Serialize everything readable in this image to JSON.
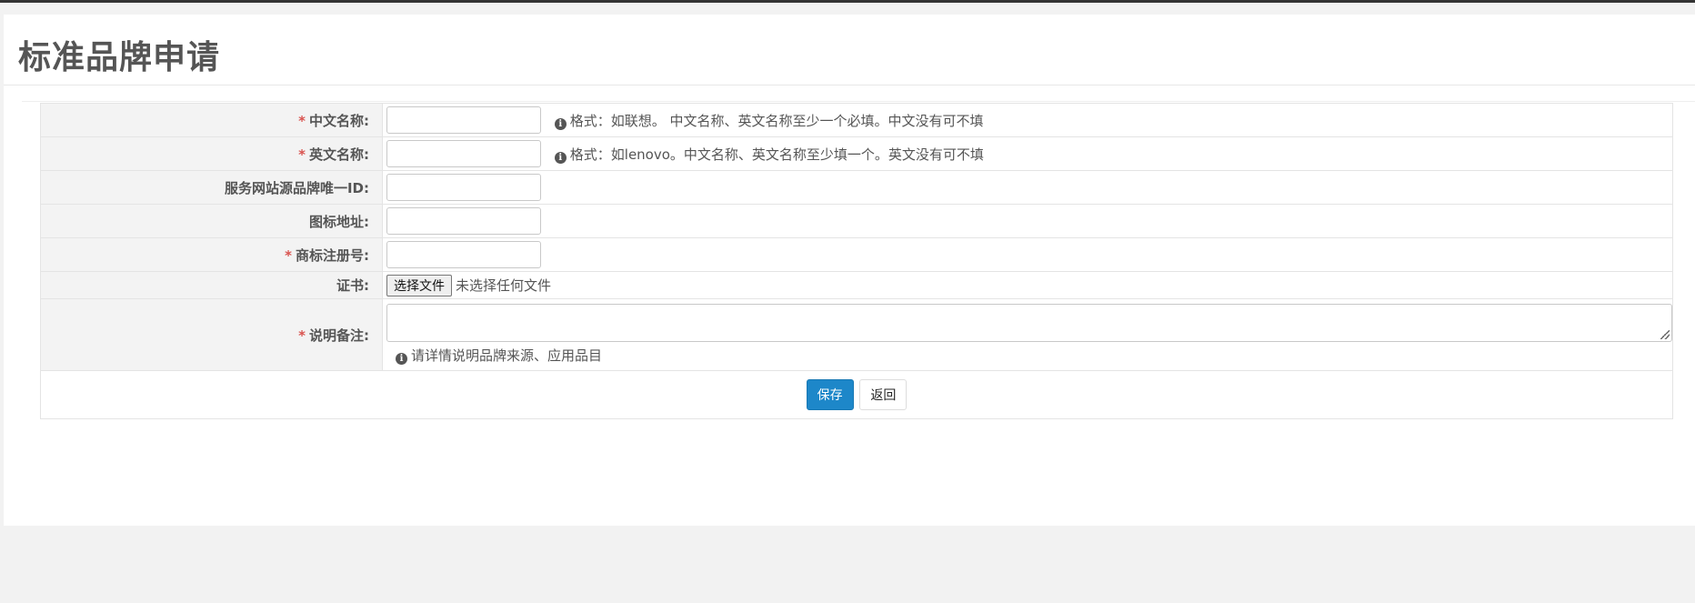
{
  "page": {
    "title": "标准品牌申请"
  },
  "form": {
    "required_mark": "*",
    "fields": [
      {
        "label": "中文名称:",
        "required": true,
        "value": "",
        "hint": "格式：如联想。 中文名称、英文名称至少一个必填。中文没有可不填"
      },
      {
        "label": "英文名称:",
        "required": true,
        "value": "",
        "hint": "格式：如lenovo。中文名称、英文名称至少填一个。英文没有可不填"
      },
      {
        "label": "服务网站源品牌唯一ID:",
        "required": false,
        "value": ""
      },
      {
        "label": "图标地址:",
        "required": false,
        "value": ""
      },
      {
        "label": "商标注册号:",
        "required": true,
        "value": ""
      }
    ],
    "certificate": {
      "label": "证书:",
      "button": "选择文件",
      "status": "未选择任何文件"
    },
    "remarks": {
      "label": "说明备注:",
      "required": true,
      "value": "",
      "hint": "请详情说明品牌来源、应用品目"
    }
  },
  "actions": {
    "save_label": "保存",
    "back_label": "返回"
  },
  "icons": {
    "hint": "info-icon"
  },
  "colors": {
    "required": "#d9534f",
    "primary": "#1d87c9"
  }
}
